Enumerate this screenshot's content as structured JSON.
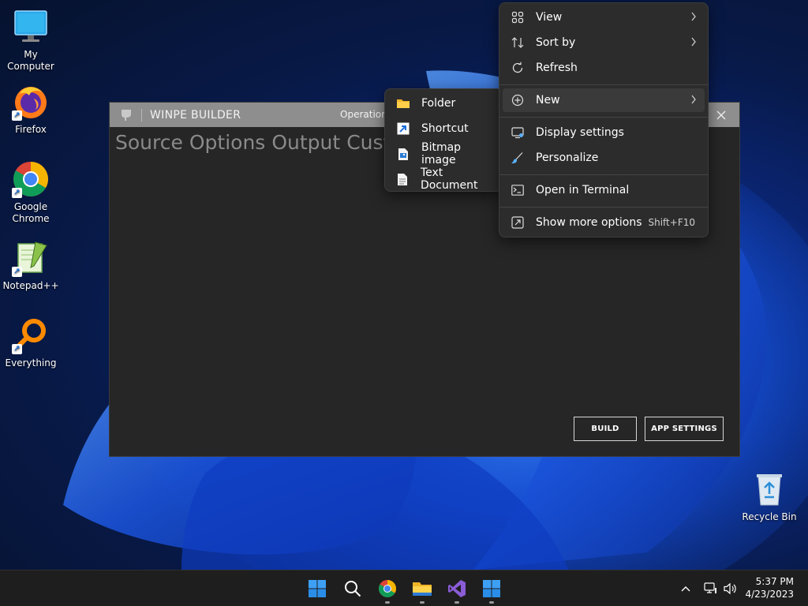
{
  "desktop": {
    "icons": [
      {
        "label": "My Computer"
      },
      {
        "label": "Firefox"
      },
      {
        "label": "Google Chrome"
      },
      {
        "label": "Notepad++"
      },
      {
        "label": "Everything"
      },
      {
        "label": "Recycle Bin"
      }
    ]
  },
  "app": {
    "title": "WINPE BUILDER",
    "operation_label": "Operation",
    "tabs": [
      "Source",
      "Options",
      "Output",
      "Cust"
    ],
    "build_label": "BUILD",
    "settings_label": "APP SETTINGS"
  },
  "context_menu": {
    "items": [
      {
        "label": "View",
        "icon": "view-icon",
        "has_submenu": true
      },
      {
        "label": "Sort by",
        "icon": "sort-icon",
        "has_submenu": true
      },
      {
        "label": "Refresh",
        "icon": "refresh-icon",
        "has_submenu": false
      },
      {
        "label": "New",
        "icon": "new-icon",
        "has_submenu": true
      },
      {
        "label": "Display settings",
        "icon": "display-icon",
        "has_submenu": false
      },
      {
        "label": "Personalize",
        "icon": "brush-icon",
        "has_submenu": false
      },
      {
        "label": "Open in Terminal",
        "icon": "terminal-icon",
        "has_submenu": false
      },
      {
        "label": "Show more options",
        "icon": "more-options-icon",
        "shortcut": "Shift+F10"
      }
    ]
  },
  "new_submenu": {
    "items": [
      {
        "label": "Folder",
        "icon": "folder-icon"
      },
      {
        "label": "Shortcut",
        "icon": "shortcut-icon"
      },
      {
        "label": "Bitmap image",
        "icon": "bitmap-icon"
      },
      {
        "label": "Text Document",
        "icon": "text-document-icon"
      }
    ]
  },
  "taskbar": {
    "time": "5:37 PM",
    "date": "4/23/2023"
  },
  "colors": {
    "accent": "#0078d4",
    "menu_bg": "#2c2c2c",
    "app_bg": "#262626",
    "titlebar": "#8e8e8e"
  }
}
